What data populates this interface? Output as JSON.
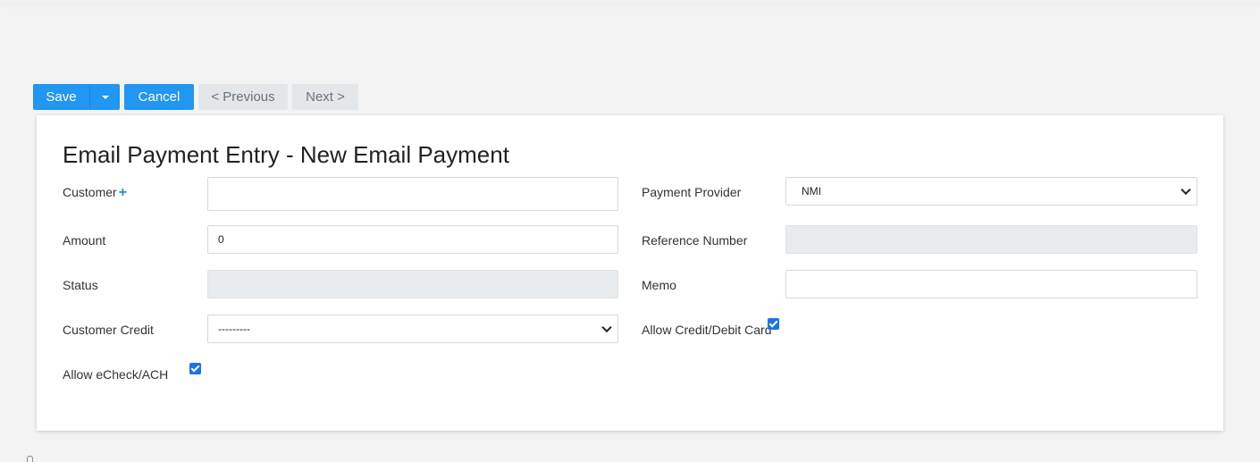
{
  "toolbar": {
    "save_label": "Save",
    "cancel_label": "Cancel",
    "previous_label": "< Previous",
    "next_label": "Next >"
  },
  "page": {
    "title": "Email Payment Entry - New Email Payment"
  },
  "form": {
    "customer": {
      "label": "Customer",
      "value": ""
    },
    "amount": {
      "label": "Amount",
      "value": "0"
    },
    "status": {
      "label": "Status",
      "value": ""
    },
    "customer_credit": {
      "label": "Customer Credit",
      "selected": "---------"
    },
    "allow_echeck": {
      "label": "Allow eCheck/ACH",
      "checked": true
    },
    "payment_provider": {
      "label": "Payment Provider",
      "selected": "NMI"
    },
    "reference_number": {
      "label": "Reference Number",
      "value": ""
    },
    "memo": {
      "label": "Memo",
      "value": ""
    },
    "allow_card": {
      "label": "Allow Credit/Debit Card",
      "checked": true
    }
  },
  "colors": {
    "primary": "#2196f3",
    "disabled_bg": "#e4e7ea",
    "readonly_bg": "#e9ecef",
    "checkbox": "#1a73e8"
  },
  "icons": {
    "customer_add": "plus-icon",
    "save_dropdown": "caret-down-icon",
    "select_arrow": "chevron-down-icon"
  }
}
